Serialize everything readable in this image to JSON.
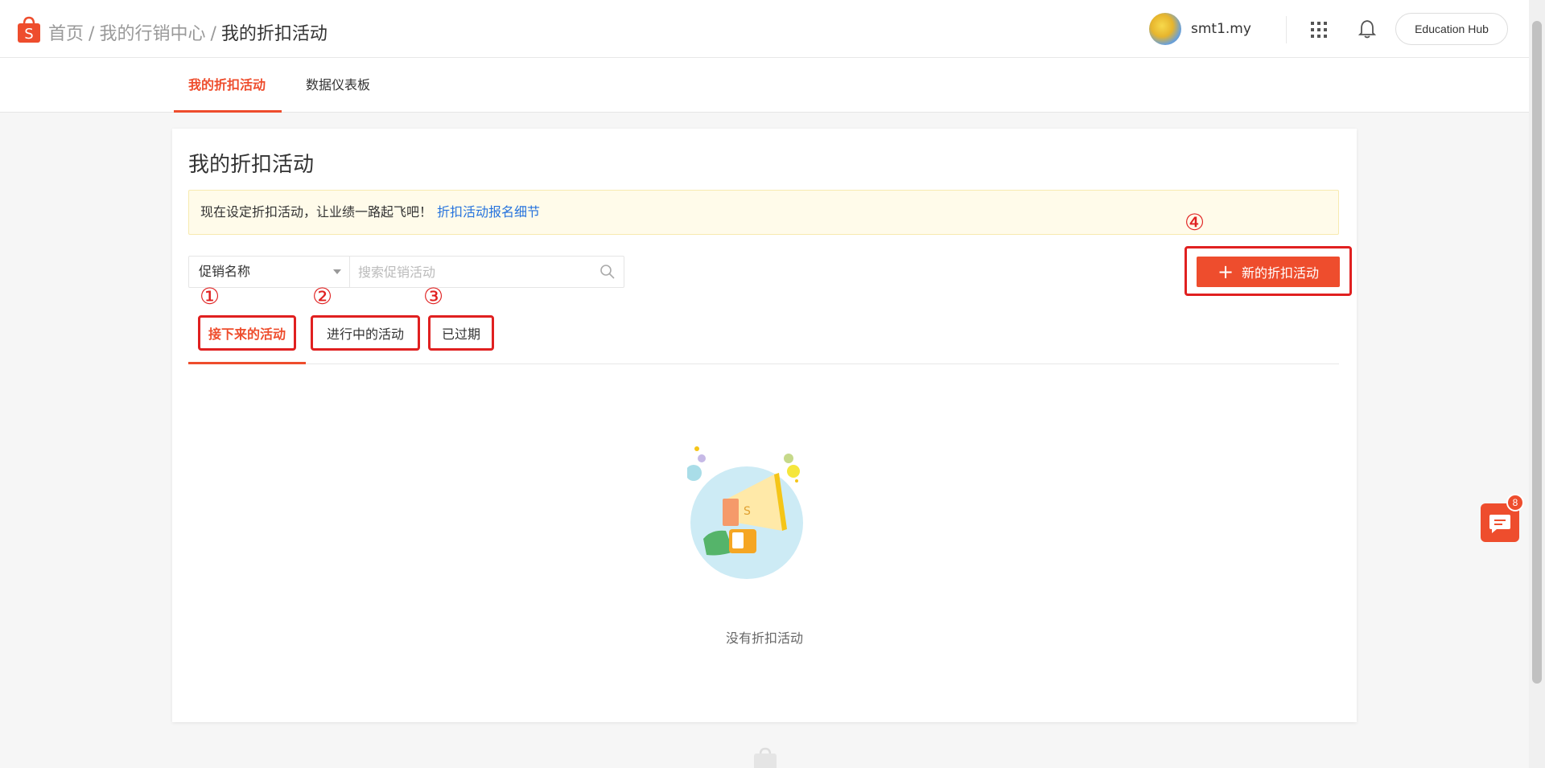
{
  "header": {
    "breadcrumb": {
      "home": "首页",
      "sep1": "/",
      "marketing": "我的行销中心",
      "sep2": "/",
      "current": "我的折扣活动"
    },
    "username": "smt1.my",
    "education_hub": "Education Hub"
  },
  "subnav": {
    "tabs": [
      {
        "label": "我的折扣活动",
        "active": true
      },
      {
        "label": "数据仪表板",
        "active": false
      }
    ]
  },
  "card": {
    "title": "我的折扣活动",
    "notice": {
      "text": "现在设定折扣活动，让业绩一路起飞吧！",
      "link": "折扣活动报名细节"
    },
    "search": {
      "select_value": "促销名称",
      "placeholder": "搜索促销活动"
    },
    "new_button": {
      "icon": "+",
      "label": "新的折扣活动"
    },
    "markers": [
      "①",
      "②",
      "③",
      "④"
    ],
    "tabs": [
      {
        "label": "接下来的活动",
        "active": true
      },
      {
        "label": "进行中的活动",
        "active": false
      },
      {
        "label": "已过期",
        "active": false
      }
    ],
    "empty_text": "没有折扣活动"
  },
  "chat": {
    "badge": "8"
  },
  "colors": {
    "brand": "#ee4d2d",
    "annotation_red": "#e02020",
    "link": "#2673dd"
  }
}
